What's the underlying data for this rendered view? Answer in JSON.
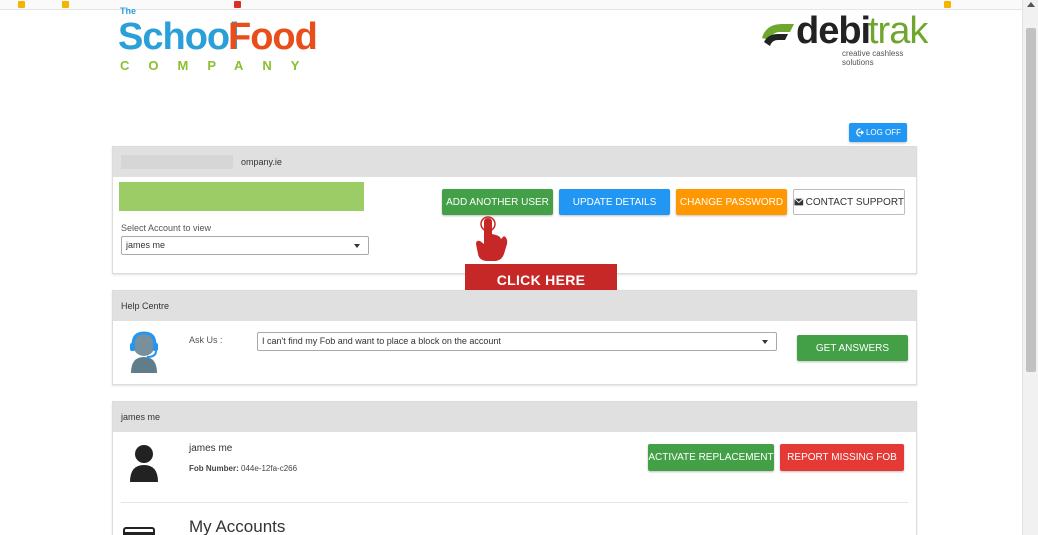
{
  "colors": {
    "blue": "#2196f3",
    "green": "#43a047",
    "orange": "#ff9800",
    "red": "#e53935",
    "banner": "#c62828",
    "logo_blue": "#2b9fd8",
    "logo_orange": "#e84e1c",
    "logo_green": "#8bbf2e",
    "debitrak_green": "#6fa72e"
  },
  "logo_left": {
    "the": "The",
    "school": "School",
    "food": "Food",
    "company": "COMPANY"
  },
  "logo_right": {
    "debi": "debi",
    "trak": "trak",
    "tagline": "creative cashless solutions"
  },
  "header": {
    "logoff_icon": "logout-icon",
    "logoff_label": "LOG OFF"
  },
  "account_panel": {
    "email_partial": "ompany.ie",
    "buttons": {
      "add_user": "ADD ANOTHER USER",
      "update_details": "UPDATE DETAILS",
      "change_password": "CHANGE PASSWORD",
      "contact_support": "CONTACT SUPPORT"
    },
    "contact_icon": "envelope-icon",
    "select_label": "Select Account to view",
    "select_value": "james me"
  },
  "callout": {
    "label": "CLICK HERE",
    "icon": "hand-pointer-icon"
  },
  "help_panel": {
    "title": "Help Centre",
    "ask_label": "Ask Us :",
    "question_value": "I can't find my Fob and want to place a block on the account",
    "button": "GET ANSWERS",
    "icon": "support-agent-icon"
  },
  "user_panel": {
    "title": "james me",
    "user_name": "james me",
    "fob_label": "Fob Number:",
    "fob_value": "044e-12fa-c266",
    "activate_button": "ACTIVATE REPLACEMENT",
    "report_button": "REPORT MISSING FOB",
    "avatar_icon": "user-icon",
    "my_accounts_title": "My Accounts",
    "accounts_icon": "card-icon"
  }
}
